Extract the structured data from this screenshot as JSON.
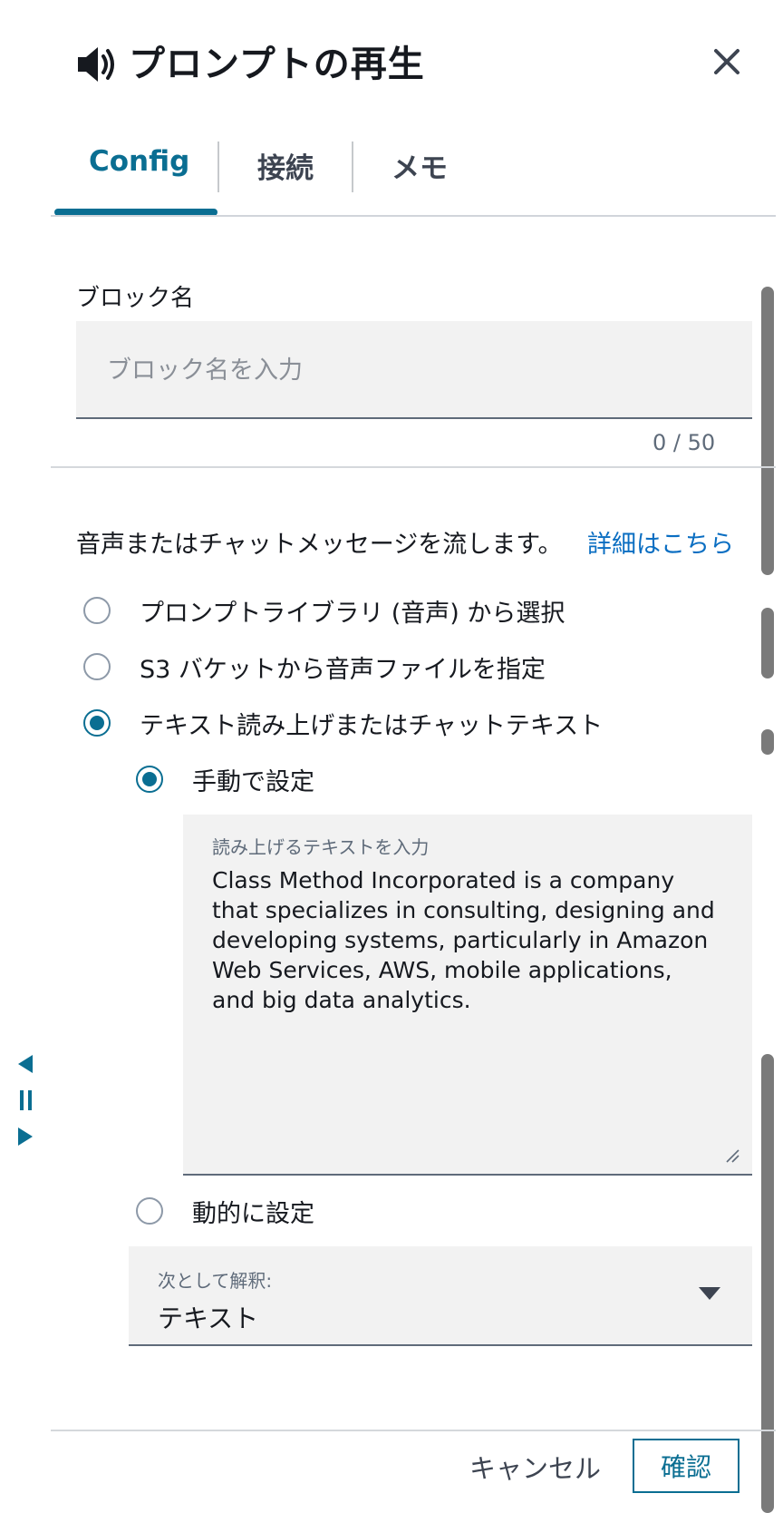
{
  "header": {
    "title": "プロンプトの再生",
    "icon": "speaker-icon",
    "close_icon": "close-icon"
  },
  "tabs": [
    {
      "label": "Config",
      "active": true
    },
    {
      "label": "接続",
      "active": false
    },
    {
      "label": "メモ",
      "active": false
    }
  ],
  "block_name": {
    "label": "ブロック名",
    "placeholder": "ブロック名を入力",
    "value": "",
    "char_count": "0 / 50"
  },
  "description": {
    "text": "音声またはチャットメッセージを流します。",
    "link": "詳細はこちら"
  },
  "source_options": [
    {
      "label": "プロンプトライブラリ (音声) から選択",
      "checked": false
    },
    {
      "label": "S3 バケットから音声ファイルを指定",
      "checked": false
    },
    {
      "label": "テキスト読み上げまたはチャットテキスト",
      "checked": true
    }
  ],
  "tts": {
    "manual_label": "手動で設定",
    "manual_checked": true,
    "textarea_label": "読み上げるテキストを入力",
    "textarea_value": "Class Method Incorporated is a company that specializes in consulting, designing and developing systems, particularly in Amazon Web Services, AWS, mobile applications, and big data analytics.",
    "dynamic_label": "動的に設定",
    "dynamic_checked": false
  },
  "interpret_as": {
    "label": "次として解釈:",
    "value": "テキスト"
  },
  "footer": {
    "cancel": "キャンセル",
    "confirm": "確認"
  },
  "side_controls": [
    "previous-icon",
    "pause-icon",
    "next-icon"
  ],
  "colors": {
    "accent": "#0a6e92",
    "link": "#0a6ec2",
    "field_bg": "#f2f2f2",
    "text": "#16191f"
  }
}
